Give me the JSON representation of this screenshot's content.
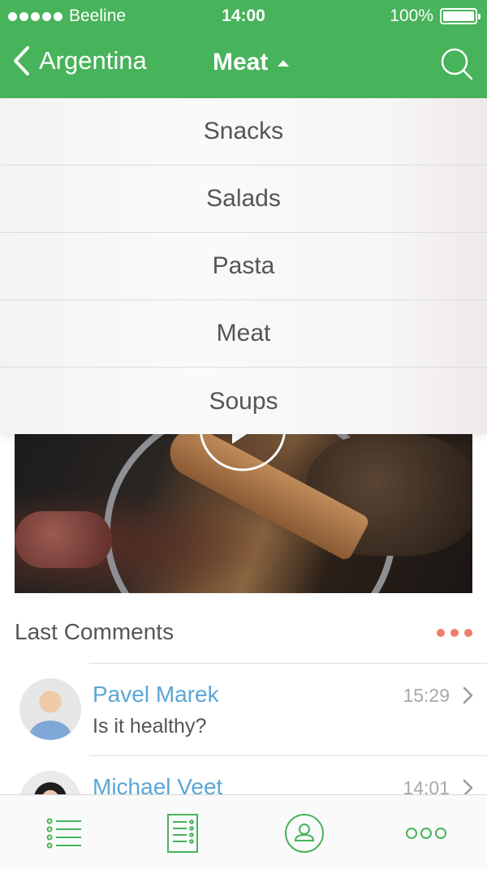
{
  "status_bar": {
    "carrier": "Beeline",
    "time": "14:00",
    "battery": "100%"
  },
  "nav": {
    "back_label": "Argentina",
    "title": "Meat",
    "icons": {
      "back": "chevron-left-icon",
      "dropdown": "caret-up-icon",
      "search": "search-icon"
    }
  },
  "category_menu": {
    "items": [
      "Snacks",
      "Salads",
      "Pasta",
      "Meat",
      "Soups"
    ]
  },
  "main": {
    "media_icon": "play-icon",
    "comments_title": "Last Comments",
    "comments": [
      {
        "name": "Pavel Marek",
        "text": "Is it healthy?",
        "time": "15:29"
      },
      {
        "name": "Michael Veet",
        "text": "",
        "time": "14:01"
      }
    ]
  },
  "tab_bar": {
    "icons": [
      "list-icon",
      "recipe-card-icon",
      "chef-icon",
      "more-icon"
    ]
  },
  "colors": {
    "brand_green": "#47b35a",
    "accent_blue": "#5aa7d6",
    "accent_coral": "#ef7d6c"
  }
}
